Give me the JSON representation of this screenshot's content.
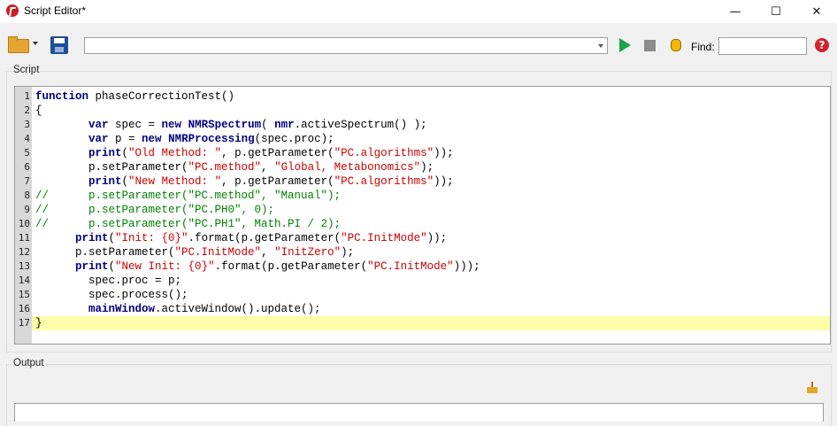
{
  "window": {
    "title": "Script Editor*",
    "minimize_glyph": "—",
    "maximize_glyph": "☐",
    "close_glyph": "✕"
  },
  "toolbar": {
    "find_label": "Find:",
    "find_value": "",
    "script_combo_value": "",
    "help_glyph": "?"
  },
  "script_group": {
    "label": "Script"
  },
  "output_group": {
    "label": "Output"
  },
  "editor": {
    "current_line": 17,
    "lines": [
      {
        "n": "1",
        "tokens": [
          {
            "t": "function ",
            "c": "k"
          },
          {
            "t": "phaseCorrectionTest()",
            "c": "o"
          }
        ]
      },
      {
        "n": "2",
        "tokens": [
          {
            "t": "{",
            "c": "o"
          }
        ]
      },
      {
        "n": "3",
        "tokens": [
          {
            "t": "        ",
            "c": "o"
          },
          {
            "t": "var ",
            "c": "k"
          },
          {
            "t": "spec = ",
            "c": "o"
          },
          {
            "t": "new ",
            "c": "k"
          },
          {
            "t": "NMRSpectrum",
            "c": "k"
          },
          {
            "t": "( ",
            "c": "o"
          },
          {
            "t": "nmr",
            "c": "k"
          },
          {
            "t": ".activeSpectrum() );",
            "c": "o"
          }
        ]
      },
      {
        "n": "4",
        "tokens": [
          {
            "t": "        ",
            "c": "o"
          },
          {
            "t": "var ",
            "c": "k"
          },
          {
            "t": "p = ",
            "c": "o"
          },
          {
            "t": "new ",
            "c": "k"
          },
          {
            "t": "NMRProcessing",
            "c": "k"
          },
          {
            "t": "(spec.proc);",
            "c": "o"
          }
        ]
      },
      {
        "n": "5",
        "tokens": [
          {
            "t": "        ",
            "c": "o"
          },
          {
            "t": "print",
            "c": "k"
          },
          {
            "t": "(",
            "c": "o"
          },
          {
            "t": "\"Old Method: \"",
            "c": "s"
          },
          {
            "t": ", p.getParameter(",
            "c": "o"
          },
          {
            "t": "\"PC.algorithms\"",
            "c": "s"
          },
          {
            "t": "));",
            "c": "o"
          }
        ]
      },
      {
        "n": "6",
        "tokens": [
          {
            "t": "        p.setParameter(",
            "c": "o"
          },
          {
            "t": "\"PC.method\"",
            "c": "s"
          },
          {
            "t": ", ",
            "c": "o"
          },
          {
            "t": "\"Global, Metabonomics\"",
            "c": "s"
          },
          {
            "t": ");",
            "c": "o"
          }
        ]
      },
      {
        "n": "7",
        "tokens": [
          {
            "t": "        ",
            "c": "o"
          },
          {
            "t": "print",
            "c": "k"
          },
          {
            "t": "(",
            "c": "o"
          },
          {
            "t": "\"New Method: \"",
            "c": "s"
          },
          {
            "t": ", p.getParameter(",
            "c": "o"
          },
          {
            "t": "\"PC.algorithms\"",
            "c": "s"
          },
          {
            "t": "));",
            "c": "o"
          }
        ]
      },
      {
        "n": "8",
        "tokens": [
          {
            "t": "//      p.setParameter(\"PC.method\", \"Manual\");",
            "c": "c"
          }
        ]
      },
      {
        "n": "9",
        "tokens": [
          {
            "t": "//      p.setParameter(\"PC.PH0\", 0);",
            "c": "c"
          }
        ]
      },
      {
        "n": "10",
        "tokens": [
          {
            "t": "//      p.setParameter(\"PC.PH1\", Math.PI / 2);",
            "c": "c"
          }
        ]
      },
      {
        "n": "11",
        "tokens": [
          {
            "t": "      ",
            "c": "o"
          },
          {
            "t": "print",
            "c": "k"
          },
          {
            "t": "(",
            "c": "o"
          },
          {
            "t": "\"Init: {0}\"",
            "c": "s"
          },
          {
            "t": ".format(p.getParameter(",
            "c": "o"
          },
          {
            "t": "\"PC.InitMode\"",
            "c": "s"
          },
          {
            "t": "));",
            "c": "o"
          }
        ]
      },
      {
        "n": "12",
        "tokens": [
          {
            "t": "      p.setParameter(",
            "c": "o"
          },
          {
            "t": "\"PC.InitMode\"",
            "c": "s"
          },
          {
            "t": ", ",
            "c": "o"
          },
          {
            "t": "\"InitZero\"",
            "c": "s"
          },
          {
            "t": ");",
            "c": "o"
          }
        ]
      },
      {
        "n": "13",
        "tokens": [
          {
            "t": "      ",
            "c": "o"
          },
          {
            "t": "print",
            "c": "k"
          },
          {
            "t": "(",
            "c": "o"
          },
          {
            "t": "\"New Init: {0}\"",
            "c": "s"
          },
          {
            "t": ".format(p.getParameter(",
            "c": "o"
          },
          {
            "t": "\"PC.InitMode\"",
            "c": "s"
          },
          {
            "t": ")));",
            "c": "o"
          }
        ]
      },
      {
        "n": "14",
        "tokens": [
          {
            "t": "        spec.proc = p;",
            "c": "o"
          }
        ]
      },
      {
        "n": "15",
        "tokens": [
          {
            "t": "        spec.process();",
            "c": "o"
          }
        ]
      },
      {
        "n": "16",
        "tokens": [
          {
            "t": "        ",
            "c": "o"
          },
          {
            "t": "mainWindow",
            "c": "k"
          },
          {
            "t": ".activeWindow().update();",
            "c": "o"
          }
        ]
      },
      {
        "n": "17",
        "tokens": [
          {
            "t": "}",
            "c": "o"
          }
        ]
      }
    ]
  },
  "colors": {
    "keyword": "#000080",
    "string": "#cc0000",
    "comment": "#008000",
    "current_line_bg": "#fdfdaa",
    "gutter_bg": "#d8d8d8"
  }
}
